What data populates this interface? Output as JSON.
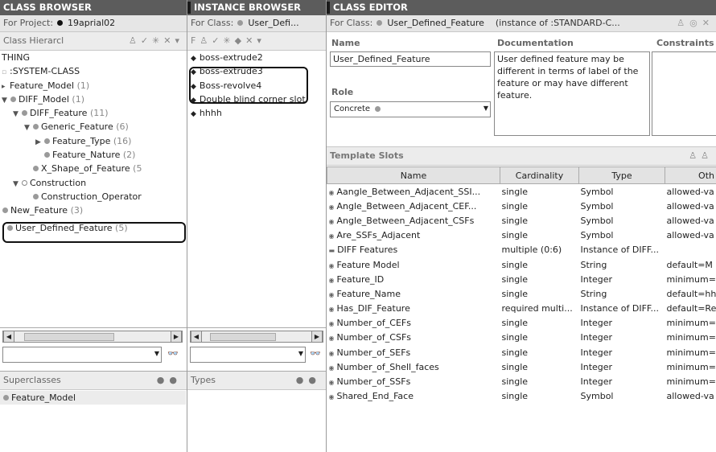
{
  "class_browser": {
    "title": "CLASS BROWSER",
    "project_label": "For Project:",
    "project_name": "19aprial02",
    "hierarchy_label": "Class Hierarcl",
    "tree": [
      {
        "label": "THING",
        "count": ""
      },
      {
        "label": ":SYSTEM-CLASS",
        "count": ""
      },
      {
        "label": "Feature_Model",
        "count": "(1)"
      },
      {
        "label": "DIFF_Model",
        "count": "(1)"
      },
      {
        "label": "DIFF_Feature",
        "count": "(11)"
      },
      {
        "label": "Generic_Feature",
        "count": "(6)"
      },
      {
        "label": "Feature_Type",
        "count": "(16)"
      },
      {
        "label": "Feature_Nature",
        "count": "(2)"
      },
      {
        "label": "X_Shape_of_Feature",
        "count": "(5"
      },
      {
        "label": "Construction",
        "count": ""
      },
      {
        "label": "Construction_Operator",
        "count": ""
      },
      {
        "label": "New_Feature",
        "count": "(3)"
      },
      {
        "label": "User_Defined_Feature",
        "count": "(5)"
      }
    ],
    "superclasses_label": "Superclasses",
    "superclasses": [
      "Feature_Model"
    ]
  },
  "instance_browser": {
    "title": "INSTANCE BROWSER",
    "for_class_label": "For Class:",
    "class_name": "User_Defi...",
    "instances": [
      "boss-extrude2",
      "boss-extrude3",
      "Boss-revolve4",
      "Double blind corner slot",
      "hhhh"
    ],
    "types_label": "Types"
  },
  "class_editor": {
    "title": "CLASS EDITOR",
    "for_class_label": "For Class:",
    "class_name": "User_Defined_Feature",
    "instance_of": "(instance of :STANDARD-C...",
    "name_label": "Name",
    "name_value": "User_Defined_Feature",
    "documentation_label": "Documentation",
    "documentation_value": "User defined feature may be different in terms of label of the feature or may have different feature.",
    "constraints_label": "Constraints",
    "role_label": "Role",
    "role_value": "Concrete",
    "template_slots_label": "Template Slots",
    "columns": [
      "Name",
      "Cardinality",
      "Type",
      "Oth"
    ],
    "slots": [
      [
        "Aangle_Between_Adjacent_SSI...",
        "single",
        "Symbol",
        "allowed-va"
      ],
      [
        "Angle_Between_Adjacent_CEF...",
        "single",
        "Symbol",
        "allowed-va"
      ],
      [
        "Angle_Between_Adjacent_CSFs",
        "single",
        "Symbol",
        "allowed-va"
      ],
      [
        "Are_SSFs_Adjacent",
        "single",
        "Symbol",
        "allowed-va"
      ],
      [
        "DIFF Features",
        "multiple   (0:6)",
        "Instance of DIFF...",
        ""
      ],
      [
        "Feature Model",
        "single",
        "String",
        "default=M"
      ],
      [
        "Feature_ID",
        "single",
        "Integer",
        "minimum="
      ],
      [
        "Feature_Name",
        "single",
        "String",
        "default=hh"
      ],
      [
        "Has_DIF_Feature",
        "required multi...",
        "Instance of DIFF...",
        "default=Re"
      ],
      [
        "Number_of_CEFs",
        "single",
        "Integer",
        "minimum="
      ],
      [
        "Number_of_CSFs",
        "single",
        "Integer",
        "minimum="
      ],
      [
        "Number_of_SEFs",
        "single",
        "Integer",
        "minimum="
      ],
      [
        "Number_of_Shell_faces",
        "single",
        "Integer",
        "minimum="
      ],
      [
        "Number_of_SSFs",
        "single",
        "Integer",
        "minimum="
      ],
      [
        "Shared_End_Face",
        "single",
        "Symbol",
        "allowed-va"
      ]
    ]
  }
}
